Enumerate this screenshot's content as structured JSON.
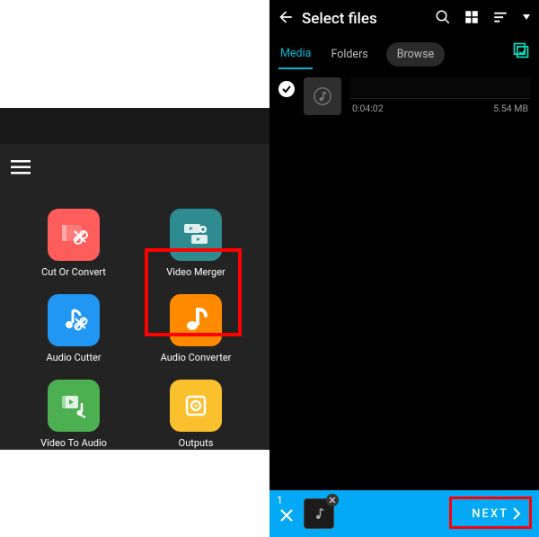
{
  "left": {
    "grid": [
      {
        "label": "Cut Or Convert",
        "name": "cut-or-convert",
        "bg": "#ff5c5c"
      },
      {
        "label": "Video Merger",
        "name": "video-merger",
        "bg": "#2e8b8f"
      },
      {
        "label": "Audio Cutter",
        "name": "audio-cutter",
        "bg": "#2196f3"
      },
      {
        "label": "Audio Converter",
        "name": "audio-converter",
        "bg": "#ff8a00"
      },
      {
        "label": "Video To Audio",
        "name": "video-to-audio",
        "bg": "#4caf50"
      },
      {
        "label": "Outputs",
        "name": "outputs",
        "bg": "#fbc02d"
      }
    ]
  },
  "right": {
    "title": "Select files",
    "tabs": {
      "media": "Media",
      "folders": "Folders",
      "browse": "Browse"
    },
    "file": {
      "duration": "0:04:02",
      "size": "5.54 MB"
    },
    "footer": {
      "count": "1",
      "next": "NEXT"
    }
  }
}
